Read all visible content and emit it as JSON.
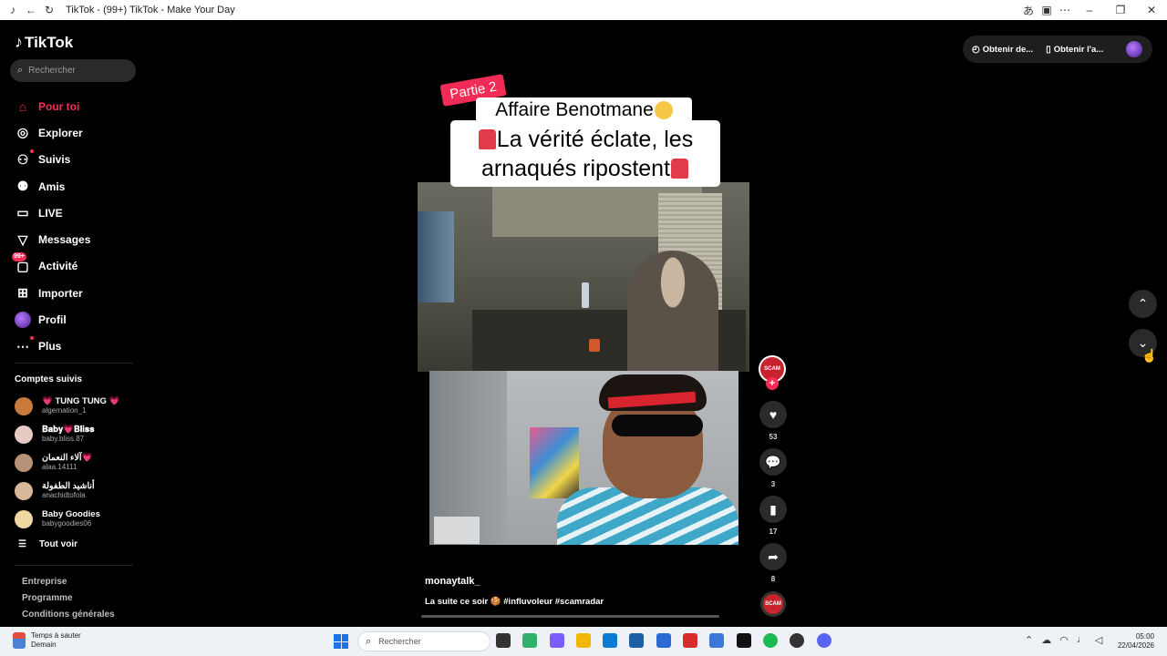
{
  "window": {
    "title": "TikTok - (99+) TikTok - Make Your Day",
    "controls": [
      "minimize",
      "maximize",
      "close"
    ]
  },
  "sidebar": {
    "logo": "TikTok",
    "search_placeholder": "Rechercher",
    "nav": [
      {
        "label": "Pour toi",
        "icon": "home-icon",
        "active": true
      },
      {
        "label": "Explorer",
        "icon": "compass-icon"
      },
      {
        "label": "Suivis",
        "icon": "following-icon",
        "dot": true
      },
      {
        "label": "Amis",
        "icon": "friends-icon"
      },
      {
        "label": "LIVE",
        "icon": "live-icon"
      },
      {
        "label": "Messages",
        "icon": "messages-icon"
      },
      {
        "label": "Activité",
        "icon": "activity-icon",
        "badge": "99+"
      },
      {
        "label": "Importer",
        "icon": "upload-icon"
      },
      {
        "label": "Profil",
        "icon": "profile-avatar"
      },
      {
        "label": "Plus",
        "icon": "more-icon",
        "dot": true
      }
    ],
    "following_title": "Comptes suivis",
    "following": [
      {
        "name": "💗 TUNG TUNG 💗",
        "handle": "algernation_1",
        "color": "#c77a3a"
      },
      {
        "name": "𝐁𝐚𝐛𝐲💗𝐁𝐥𝐢𝐬𝐬",
        "handle": "baby.bliss.87",
        "color": "#e7c9c3"
      },
      {
        "name": "آلاء النعمان💗",
        "handle": "alaa.14111",
        "color": "#b89278"
      },
      {
        "name": "أناشيد الطفولة",
        "handle": "anachidtofola",
        "color": "#d8b79b"
      },
      {
        "name": "Baby Goodies",
        "handle": "babygoodies06",
        "color": "#f1d8a2"
      }
    ],
    "see_all": "Tout voir",
    "footer_links": [
      "Entreprise",
      "Programme",
      "Conditions générales"
    ]
  },
  "topright": {
    "get_coins": "Obtenir de...",
    "get_app": "Obtenir l'a..."
  },
  "video": {
    "overlay_tag": "Partie 2",
    "overlay_line1": "Affaire Benotmane",
    "overlay_line2a": "La vérité éclate, les",
    "overlay_line2b": "arnaqués ripostent",
    "author": "monaytalk_",
    "description": "La suite ce soir 🍪 #influvoleur #scamradar"
  },
  "actions": {
    "avatar_label": "SCAM",
    "likes": "53",
    "comments": "3",
    "saves": "17",
    "shares": "8",
    "disc_label": "SCAM"
  },
  "taskbar": {
    "weather_line1": "Temps à sauter",
    "weather_line2": "Demain",
    "search_placeholder": "Rechercher",
    "time": "05:00",
    "date": "22/04/2026",
    "apps": [
      "#333",
      "#2fb36b",
      "#7a5cff",
      "#f2b705",
      "#0c7bd6",
      "#1b5fa8",
      "#2b6bd3",
      "#d82b2b",
      "#3b78d8",
      "#111",
      "#1db954",
      "#333",
      "#5865f2"
    ]
  }
}
